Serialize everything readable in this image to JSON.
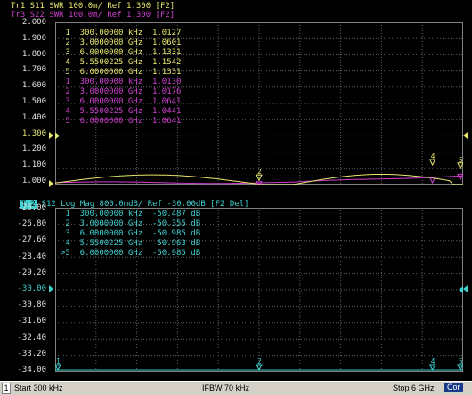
{
  "top_header": {
    "line1": "Tr1 S11 SWR 100.0m/ Ref 1.300 [F2]",
    "line2": "Tr3 S22 SWR 100.0m/ Ref 1.300 [F2]"
  },
  "top_panel": {
    "y_ticks": [
      "2.000",
      "1.900",
      "1.800",
      "1.700",
      "1.600",
      "1.500",
      "1.400",
      "1.300",
      "1.200",
      "1.100",
      "1.000"
    ],
    "ref_value": "1.300",
    "markers_tr1": [
      {
        "n": "1",
        "freq": "300.00000 kHz",
        "val": "1.0127"
      },
      {
        "n": "2",
        "freq": "3.0000000 GHz",
        "val": "1.0601"
      },
      {
        "n": "3",
        "freq": "6.0000000 GHz",
        "val": "1.1331"
      },
      {
        "n": "4",
        "freq": "5.5500225 GHz",
        "val": "1.1542"
      },
      {
        "n": "5",
        "freq": "6.0000000 GHz",
        "val": "1.1331"
      }
    ],
    "markers_tr3": [
      {
        "n": "1",
        "freq": "300.00000 kHz",
        "val": "1.0130"
      },
      {
        "n": "2",
        "freq": "3.0000000 GHz",
        "val": "1.0176"
      },
      {
        "n": "3",
        "freq": "6.0000000 GHz",
        "val": "1.0641"
      },
      {
        "n": "4",
        "freq": "5.5500225 GHz",
        "val": "1.0441"
      },
      {
        "n": "5",
        "freq": "6.0000000 GHz",
        "val": "1.0641"
      }
    ]
  },
  "bottom_header": {
    "badge": "Tr2",
    "text": "S12 Log Mag 800.0mdB/ Ref -30.00dB [F2 Del]"
  },
  "bottom_panel": {
    "y_ticks": [
      "-26.00",
      "-26.80",
      "-27.60",
      "-28.40",
      "-29.20",
      "-30.00",
      "-30.80",
      "-31.60",
      "-32.40",
      "-33.20",
      "-34.00"
    ],
    "ref_value": "-30.00",
    "markers": [
      {
        "n": "1",
        "freq": "300.00000 kHz",
        "val": "-50.487 dB"
      },
      {
        "n": "2",
        "freq": "3.0000000 GHz",
        "val": "-50.355 dB"
      },
      {
        "n": "3",
        "freq": "6.0000000 GHz",
        "val": "-50.985 dB"
      },
      {
        "n": "4",
        "freq": "5.5500225 GHz",
        "val": "-50.963 dB"
      },
      {
        "n": ">5",
        "freq": "6.0000000 GHz",
        "val": "-50.985 dB"
      }
    ]
  },
  "status_bar": {
    "channel": "1",
    "start": "Start 300 kHz",
    "ifbw": "IFBW 70 kHz",
    "stop": "Stop 6 GHz",
    "cor": "Cor"
  },
  "colors": {
    "tr1": "#e8e870",
    "tr3": "#d040d0",
    "tr2": "#40d0d0",
    "grid": "#606060"
  }
}
